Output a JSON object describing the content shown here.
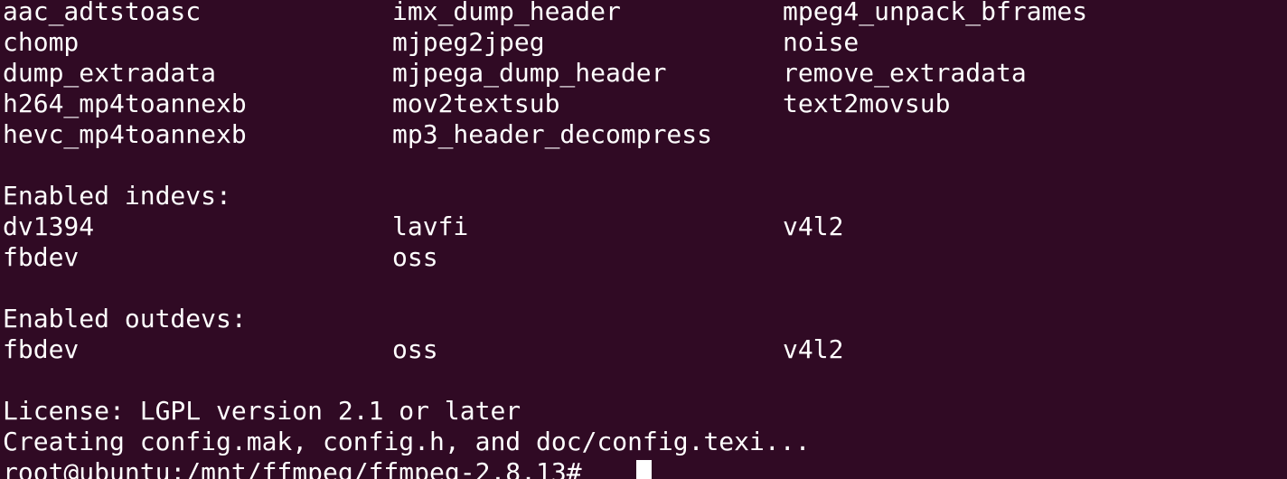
{
  "terminal": {
    "bsf_rows": [
      [
        "aac_adtstoasc",
        "imx_dump_header",
        "mpeg4_unpack_bframes"
      ],
      [
        "chomp",
        "mjpeg2jpeg",
        "noise"
      ],
      [
        "dump_extradata",
        "mjpega_dump_header",
        "remove_extradata"
      ],
      [
        "h264_mp4toannexb",
        "mov2textsub",
        "text2movsub"
      ],
      [
        "hevc_mp4toannexb",
        "mp3_header_decompress",
        ""
      ]
    ],
    "indevs_header": "Enabled indevs:",
    "indevs_rows": [
      [
        "dv1394",
        "lavfi",
        "v4l2"
      ],
      [
        "fbdev",
        "oss",
        ""
      ]
    ],
    "outdevs_header": "Enabled outdevs:",
    "outdevs_rows": [
      [
        "fbdev",
        "oss",
        "v4l2"
      ]
    ],
    "license_line": "License: LGPL version 2.1 or later",
    "creating_line": "Creating config.mak, config.h, and doc/config.texi...",
    "prompt": "root@ubuntu:/mnt/ffmpeg/ffmpeg-2.8.13#"
  },
  "colors": {
    "background": "#300a24",
    "foreground": "#ffffff"
  }
}
